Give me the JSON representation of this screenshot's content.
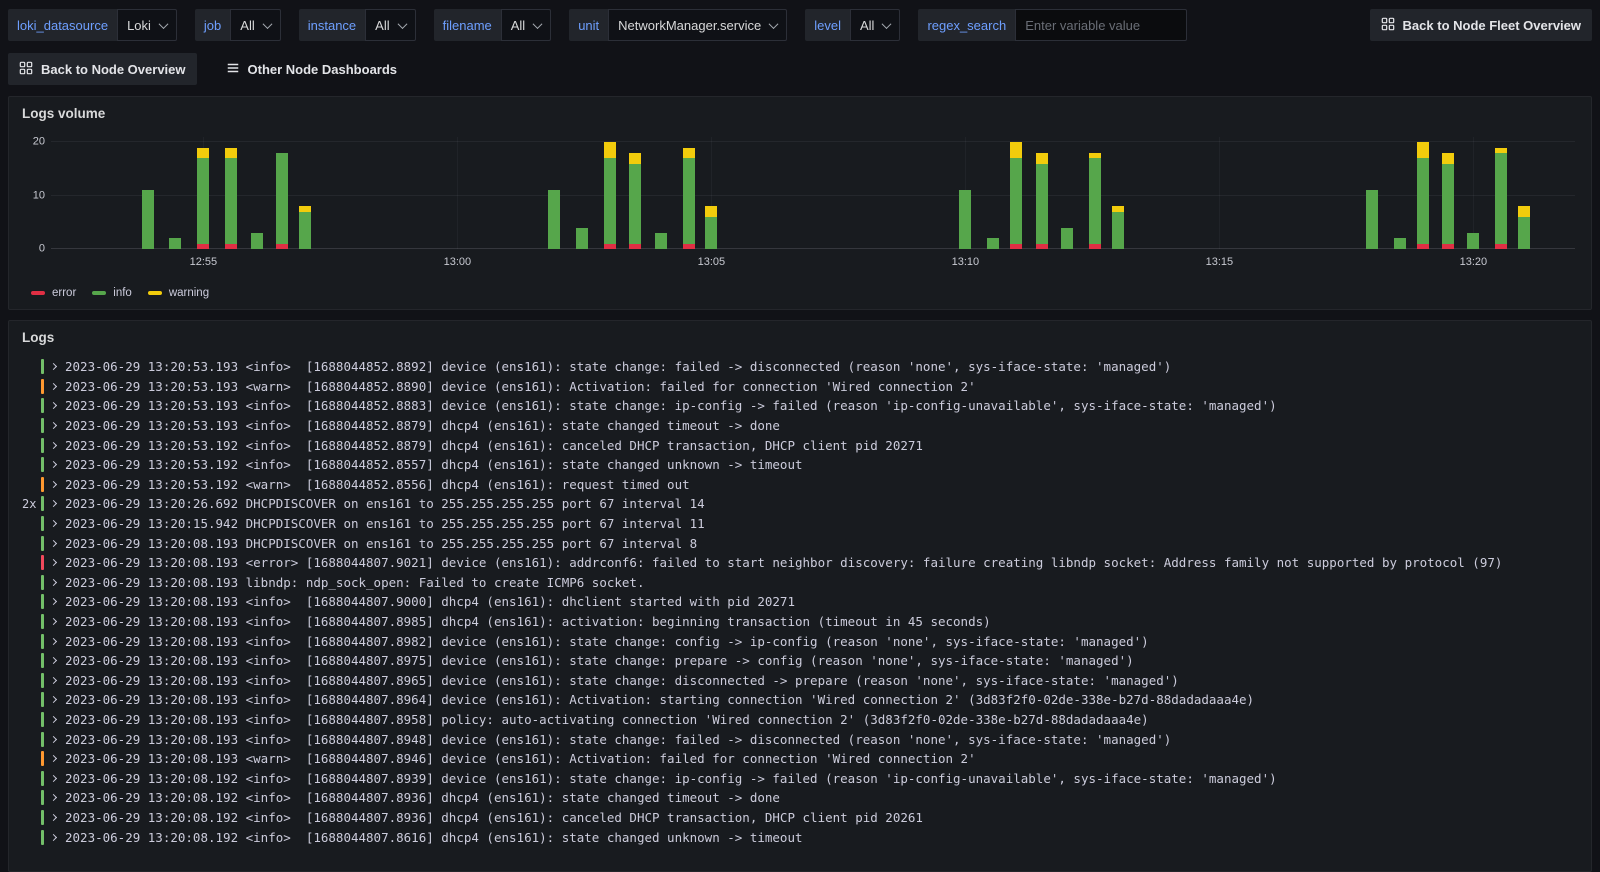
{
  "toolbar": {
    "variables": [
      {
        "label": "loki_datasource",
        "value": "Loki"
      },
      {
        "label": "job",
        "value": "All"
      },
      {
        "label": "instance",
        "value": "All"
      },
      {
        "label": "filename",
        "value": "All"
      },
      {
        "label": "unit",
        "value": "NetworkManager.service"
      },
      {
        "label": "level",
        "value": "All"
      },
      {
        "label": "regex_search",
        "placeholder": "Enter variable value"
      }
    ],
    "fleet_button": "Back to Node Fleet Overview"
  },
  "submenu": {
    "back_button": "Back to Node Overview",
    "dashboards_link": "Other Node Dashboards"
  },
  "logs_volume_panel": {
    "title": "Logs volume",
    "legend": [
      {
        "label": "error",
        "color": "#e02f44"
      },
      {
        "label": "info",
        "color": "#56a64b"
      },
      {
        "label": "warning",
        "color": "#f2cc0c"
      }
    ]
  },
  "chart_data": {
    "type": "bar",
    "stacked": true,
    "title": "Logs volume",
    "xlabel": "time",
    "ylabel": "count",
    "x_axis": "minutes after 12:52, range maps left edge 12:52 to right edge 13:22",
    "x_range_minutes": [
      0,
      30
    ],
    "ylim": [
      0,
      21
    ],
    "yticks": [
      0,
      10,
      20
    ],
    "xticks": [
      {
        "t": 3,
        "label": "12:55"
      },
      {
        "t": 8,
        "label": "13:00"
      },
      {
        "t": 13,
        "label": "13:05"
      },
      {
        "t": 18,
        "label": "13:10"
      },
      {
        "t": 23,
        "label": "13:15"
      },
      {
        "t": 28,
        "label": "13:20"
      }
    ],
    "series_order": [
      "error",
      "info",
      "warning"
    ],
    "series_colors": {
      "error": "#e02f44",
      "info": "#56a64b",
      "warning": "#f2cc0c"
    },
    "bars": [
      {
        "t": 1.9,
        "error": 0,
        "info": 11,
        "warning": 0
      },
      {
        "t": 2.45,
        "error": 0,
        "info": 2,
        "warning": 0
      },
      {
        "t": 3.0,
        "error": 1,
        "info": 16,
        "warning": 2
      },
      {
        "t": 3.55,
        "error": 1,
        "info": 16,
        "warning": 2
      },
      {
        "t": 4.05,
        "error": 0,
        "info": 3,
        "warning": 0
      },
      {
        "t": 4.55,
        "error": 1,
        "info": 17,
        "warning": 0
      },
      {
        "t": 5.0,
        "error": 0,
        "info": 7,
        "warning": 1
      },
      {
        "t": 9.9,
        "error": 0,
        "info": 11,
        "warning": 0
      },
      {
        "t": 10.45,
        "error": 0,
        "info": 4,
        "warning": 0
      },
      {
        "t": 11.0,
        "error": 1,
        "info": 16,
        "warning": 3
      },
      {
        "t": 11.5,
        "error": 1,
        "info": 15,
        "warning": 2
      },
      {
        "t": 12.0,
        "error": 0,
        "info": 3,
        "warning": 0
      },
      {
        "t": 12.55,
        "error": 1,
        "info": 16,
        "warning": 2
      },
      {
        "t": 13.0,
        "error": 0,
        "info": 6,
        "warning": 2
      },
      {
        "t": 18.0,
        "error": 0,
        "info": 11,
        "warning": 0
      },
      {
        "t": 18.55,
        "error": 0,
        "info": 2,
        "warning": 0
      },
      {
        "t": 19.0,
        "error": 1,
        "info": 16,
        "warning": 3
      },
      {
        "t": 19.5,
        "error": 1,
        "info": 15,
        "warning": 2
      },
      {
        "t": 20.0,
        "error": 0,
        "info": 4,
        "warning": 0
      },
      {
        "t": 20.55,
        "error": 1,
        "info": 16,
        "warning": 1
      },
      {
        "t": 21.0,
        "error": 0,
        "info": 7,
        "warning": 1
      },
      {
        "t": 26.0,
        "error": 0,
        "info": 11,
        "warning": 0
      },
      {
        "t": 26.55,
        "error": 0,
        "info": 2,
        "warning": 0
      },
      {
        "t": 27.0,
        "error": 1,
        "info": 16,
        "warning": 3
      },
      {
        "t": 27.5,
        "error": 1,
        "info": 15,
        "warning": 2
      },
      {
        "t": 28.0,
        "error": 0,
        "info": 3,
        "warning": 0
      },
      {
        "t": 28.55,
        "error": 1,
        "info": 17,
        "warning": 1
      },
      {
        "t": 29.0,
        "error": 0,
        "info": 6,
        "warning": 2
      }
    ]
  },
  "logs_panel": {
    "title": "Logs",
    "level_colors": {
      "info": "#73bf69",
      "warn": "#ff9830",
      "error": "#f2495c"
    },
    "rows": [
      {
        "count": "",
        "level": "info",
        "text": "2023-06-29 13:20:53.193 <info>  [1688044852.8892] device (ens161): state change: failed -> disconnected (reason 'none', sys-iface-state: 'managed')"
      },
      {
        "count": "",
        "level": "warn",
        "text": "2023-06-29 13:20:53.193 <warn>  [1688044852.8890] device (ens161): Activation: failed for connection 'Wired connection 2'"
      },
      {
        "count": "",
        "level": "info",
        "text": "2023-06-29 13:20:53.193 <info>  [1688044852.8883] device (ens161): state change: ip-config -> failed (reason 'ip-config-unavailable', sys-iface-state: 'managed')"
      },
      {
        "count": "",
        "level": "info",
        "text": "2023-06-29 13:20:53.193 <info>  [1688044852.8879] dhcp4 (ens161): state changed timeout -> done"
      },
      {
        "count": "",
        "level": "info",
        "text": "2023-06-29 13:20:53.192 <info>  [1688044852.8879] dhcp4 (ens161): canceled DHCP transaction, DHCP client pid 20271"
      },
      {
        "count": "",
        "level": "info",
        "text": "2023-06-29 13:20:53.192 <info>  [1688044852.8557] dhcp4 (ens161): state changed unknown -> timeout"
      },
      {
        "count": "",
        "level": "warn",
        "text": "2023-06-29 13:20:53.192 <warn>  [1688044852.8556] dhcp4 (ens161): request timed out"
      },
      {
        "count": "2x",
        "level": "info",
        "text": "2023-06-29 13:20:26.692 DHCPDISCOVER on ens161 to 255.255.255.255 port 67 interval 14"
      },
      {
        "count": "",
        "level": "info",
        "text": "2023-06-29 13:20:15.942 DHCPDISCOVER on ens161 to 255.255.255.255 port 67 interval 11"
      },
      {
        "count": "",
        "level": "info",
        "text": "2023-06-29 13:20:08.193 DHCPDISCOVER on ens161 to 255.255.255.255 port 67 interval 8"
      },
      {
        "count": "",
        "level": "error",
        "text": "2023-06-29 13:20:08.193 <error> [1688044807.9021] device (ens161): addrconf6: failed to start neighbor discovery: failure creating libndp socket: Address family not supported by protocol (97)"
      },
      {
        "count": "",
        "level": "info",
        "text": "2023-06-29 13:20:08.193 libndp: ndp_sock_open: Failed to create ICMP6 socket."
      },
      {
        "count": "",
        "level": "info",
        "text": "2023-06-29 13:20:08.193 <info>  [1688044807.9000] dhcp4 (ens161): dhclient started with pid 20271"
      },
      {
        "count": "",
        "level": "info",
        "text": "2023-06-29 13:20:08.193 <info>  [1688044807.8985] dhcp4 (ens161): activation: beginning transaction (timeout in 45 seconds)"
      },
      {
        "count": "",
        "level": "info",
        "text": "2023-06-29 13:20:08.193 <info>  [1688044807.8982] device (ens161): state change: config -> ip-config (reason 'none', sys-iface-state: 'managed')"
      },
      {
        "count": "",
        "level": "info",
        "text": "2023-06-29 13:20:08.193 <info>  [1688044807.8975] device (ens161): state change: prepare -> config (reason 'none', sys-iface-state: 'managed')"
      },
      {
        "count": "",
        "level": "info",
        "text": "2023-06-29 13:20:08.193 <info>  [1688044807.8965] device (ens161): state change: disconnected -> prepare (reason 'none', sys-iface-state: 'managed')"
      },
      {
        "count": "",
        "level": "info",
        "text": "2023-06-29 13:20:08.193 <info>  [1688044807.8964] device (ens161): Activation: starting connection 'Wired connection 2' (3d83f2f0-02de-338e-b27d-88dadadaaa4e)"
      },
      {
        "count": "",
        "level": "info",
        "text": "2023-06-29 13:20:08.193 <info>  [1688044807.8958] policy: auto-activating connection 'Wired connection 2' (3d83f2f0-02de-338e-b27d-88dadadaaa4e)"
      },
      {
        "count": "",
        "level": "info",
        "text": "2023-06-29 13:20:08.193 <info>  [1688044807.8948] device (ens161): state change: failed -> disconnected (reason 'none', sys-iface-state: 'managed')"
      },
      {
        "count": "",
        "level": "warn",
        "text": "2023-06-29 13:20:08.193 <warn>  [1688044807.8946] device (ens161): Activation: failed for connection 'Wired connection 2'"
      },
      {
        "count": "",
        "level": "info",
        "text": "2023-06-29 13:20:08.192 <info>  [1688044807.8939] device (ens161): state change: ip-config -> failed (reason 'ip-config-unavailable', sys-iface-state: 'managed')"
      },
      {
        "count": "",
        "level": "info",
        "text": "2023-06-29 13:20:08.192 <info>  [1688044807.8936] dhcp4 (ens161): state changed timeout -> done"
      },
      {
        "count": "",
        "level": "info",
        "text": "2023-06-29 13:20:08.192 <info>  [1688044807.8936] dhcp4 (ens161): canceled DHCP transaction, DHCP client pid 20261"
      },
      {
        "count": "",
        "level": "info",
        "text": "2023-06-29 13:20:08.192 <info>  [1688044807.8616] dhcp4 (ens161): state changed unknown -> timeout"
      }
    ]
  }
}
